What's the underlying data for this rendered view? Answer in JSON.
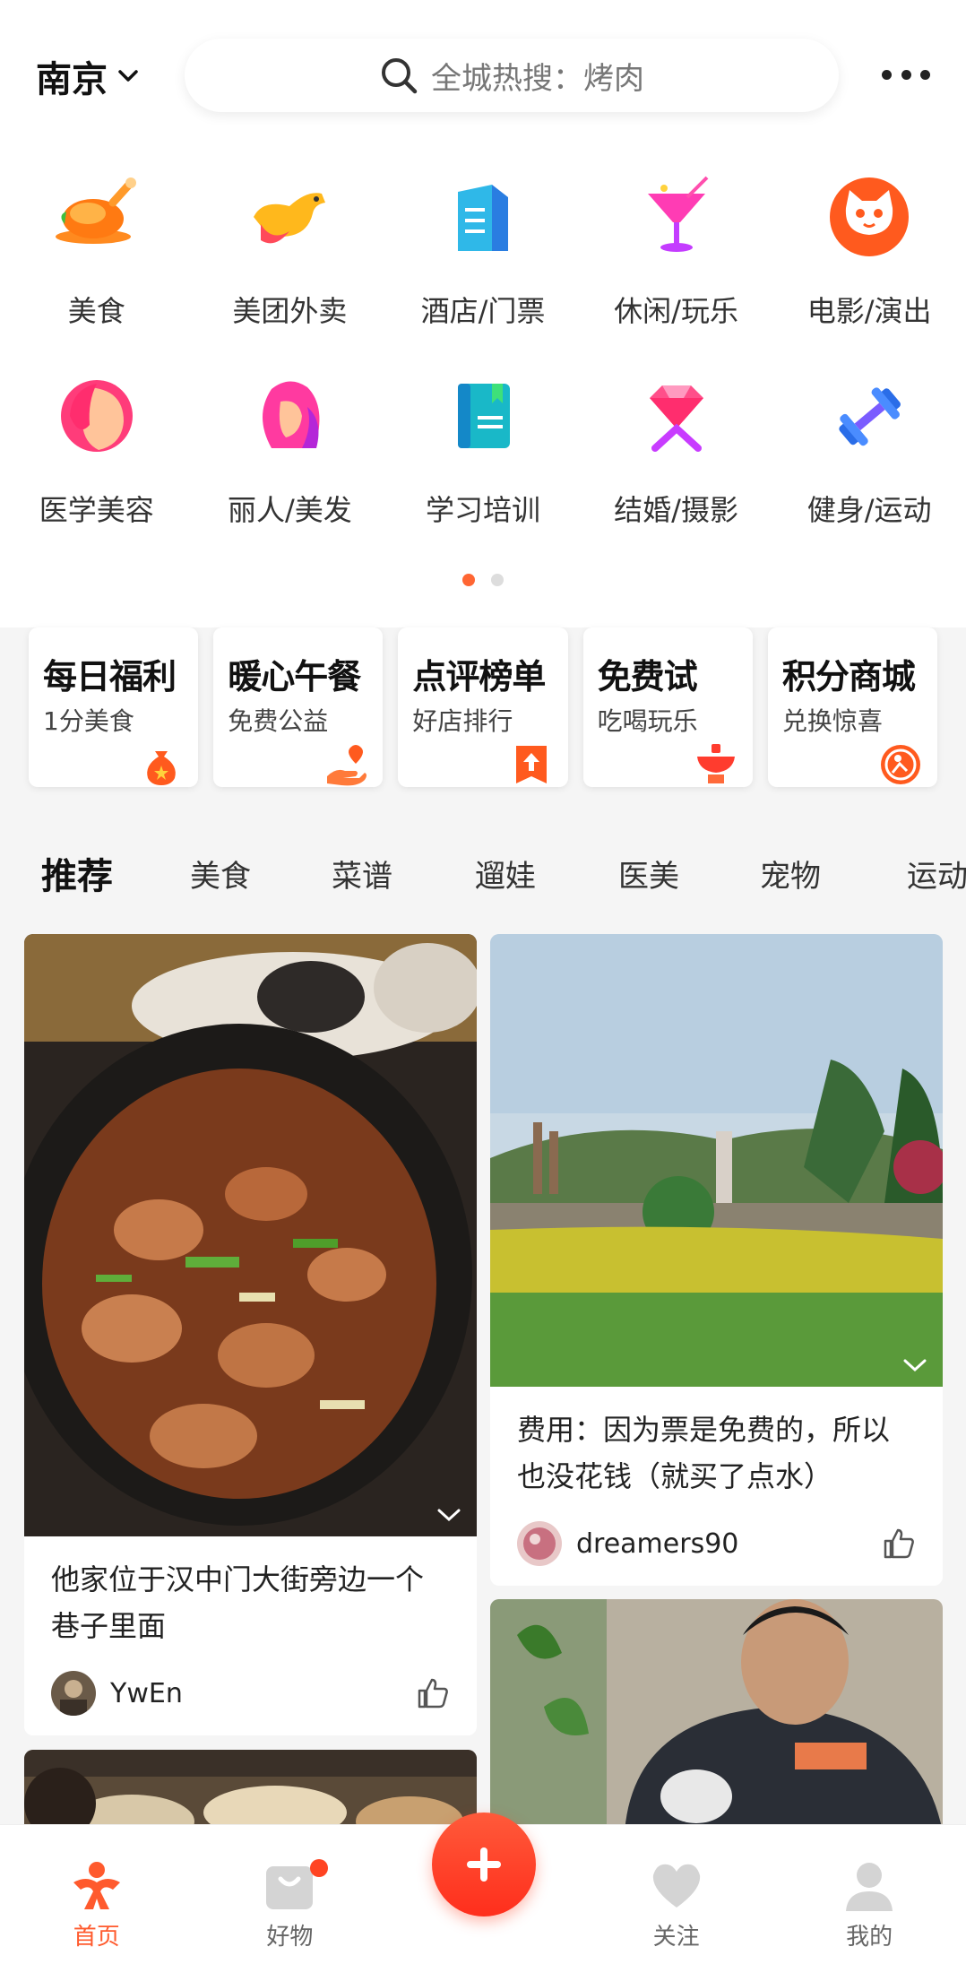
{
  "header": {
    "city": "南京",
    "search_placeholder": "全城热搜：烤肉"
  },
  "categories": [
    {
      "label": "美食",
      "icon": "roast-chicken-icon"
    },
    {
      "label": "美团外卖",
      "icon": "kangaroo-icon"
    },
    {
      "label": "酒店/门票",
      "icon": "hotel-building-icon"
    },
    {
      "label": "休闲/玩乐",
      "icon": "cocktail-icon"
    },
    {
      "label": "电影/演出",
      "icon": "cat-face-icon"
    },
    {
      "label": "医学美容",
      "icon": "woman-face-icon"
    },
    {
      "label": "丽人/美发",
      "icon": "hair-woman-icon"
    },
    {
      "label": "学习培训",
      "icon": "book-icon"
    },
    {
      "label": "结婚/摄影",
      "icon": "diamond-icon"
    },
    {
      "label": "健身/运动",
      "icon": "dumbbell-icon"
    }
  ],
  "pager": {
    "pages": 2,
    "active": 1
  },
  "welfare": [
    {
      "title": "每日福利",
      "sub": "1分美食",
      "icon": "money-bag-icon"
    },
    {
      "title": "暖心午餐",
      "sub": "免费公益",
      "icon": "heart-hand-icon"
    },
    {
      "title": "点评榜单",
      "sub": "好店排行",
      "icon": "ranking-flag-icon"
    },
    {
      "title": "免费试",
      "sub": "吃喝玩乐",
      "icon": "hotpot-icon"
    },
    {
      "title": "积分商城",
      "sub": "兑换惊喜",
      "icon": "points-coin-icon"
    }
  ],
  "tabs": [
    "推荐",
    "美食",
    "菜谱",
    "遛娃",
    "医美",
    "宠物",
    "运动"
  ],
  "feed": {
    "left": [
      {
        "caption": "他家位于汉中门大街旁边一个巷子里面",
        "user": "YwEn"
      }
    ],
    "right": [
      {
        "caption": "费用：因为票是免费的，所以也没花钱（就买了点水）",
        "user": "dreamers90"
      }
    ]
  },
  "nav": [
    {
      "label": "首页",
      "icon": "home-icon",
      "active": true
    },
    {
      "label": "好物",
      "icon": "shopping-bag-icon",
      "active": false
    },
    {
      "label": "",
      "icon": "plus-icon",
      "active": false
    },
    {
      "label": "关注",
      "icon": "heart-icon",
      "active": false
    },
    {
      "label": "我的",
      "icon": "person-icon",
      "active": false
    }
  ],
  "colors": {
    "accent": "#ff5a2d",
    "background": "#f5f5f5"
  }
}
